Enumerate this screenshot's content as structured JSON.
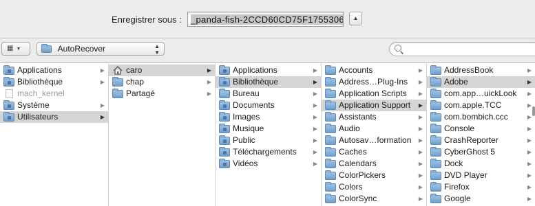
{
  "dialog": {
    "save_as_label": "Enregistrer sous :",
    "filename": "_panda-fish-2CCD60CD75F1755306",
    "expand_symbol": "▲"
  },
  "toolbar": {
    "view_symbol": "▦",
    "location": "AutoRecover",
    "search_placeholder": ""
  },
  "columns": [
    {
      "items": [
        {
          "label": "Applications",
          "icon": "app-folder-icon",
          "selected": false,
          "chevron": true
        },
        {
          "label": "Bibliothèque",
          "icon": "library-folder-icon",
          "selected": false,
          "chevron": true
        },
        {
          "label": "mach_kernel",
          "icon": "file-icon",
          "selected": false,
          "chevron": false,
          "dim": true
        },
        {
          "label": "Système",
          "icon": "system-folder-icon",
          "selected": false,
          "chevron": true
        },
        {
          "label": "Utilisateurs",
          "icon": "users-folder-icon",
          "selected": true,
          "chevron": true
        }
      ]
    },
    {
      "items": [
        {
          "label": "caro",
          "icon": "home-icon",
          "selected": true,
          "chevron": true
        },
        {
          "label": "chap",
          "icon": "folder-icon",
          "selected": false,
          "chevron": true
        },
        {
          "label": "Partagé",
          "icon": "folder-icon",
          "selected": false,
          "chevron": true
        }
      ]
    },
    {
      "items": [
        {
          "label": "Applications",
          "icon": "app-folder-icon",
          "selected": false,
          "chevron": true
        },
        {
          "label": "Bibliothèque",
          "icon": "library-folder-icon",
          "selected": true,
          "chevron": true
        },
        {
          "label": "Bureau",
          "icon": "desktop-folder-icon",
          "selected": false,
          "chevron": true
        },
        {
          "label": "Documents",
          "icon": "documents-folder-icon",
          "selected": false,
          "chevron": true
        },
        {
          "label": "Images",
          "icon": "pictures-folder-icon",
          "selected": false,
          "chevron": true
        },
        {
          "label": "Musique",
          "icon": "music-folder-icon",
          "selected": false,
          "chevron": true
        },
        {
          "label": "Public",
          "icon": "public-folder-icon",
          "selected": false,
          "chevron": true
        },
        {
          "label": "Téléchargements",
          "icon": "downloads-folder-icon",
          "selected": false,
          "chevron": true
        },
        {
          "label": "Vidéos",
          "icon": "movies-folder-icon",
          "selected": false,
          "chevron": true
        }
      ]
    },
    {
      "items": [
        {
          "label": "Accounts",
          "icon": "folder-icon",
          "selected": false,
          "chevron": true
        },
        {
          "label": "Address…Plug-Ins",
          "icon": "folder-icon",
          "selected": false,
          "chevron": true
        },
        {
          "label": "Application Scripts",
          "icon": "folder-icon",
          "selected": false,
          "chevron": true
        },
        {
          "label": "Application Support",
          "icon": "folder-icon",
          "selected": true,
          "chevron": true
        },
        {
          "label": "Assistants",
          "icon": "folder-icon",
          "selected": false,
          "chevron": true
        },
        {
          "label": "Audio",
          "icon": "folder-icon",
          "selected": false,
          "chevron": true
        },
        {
          "label": "Autosav…formation",
          "icon": "folder-icon",
          "selected": false,
          "chevron": true
        },
        {
          "label": "Caches",
          "icon": "folder-icon",
          "selected": false,
          "chevron": true
        },
        {
          "label": "Calendars",
          "icon": "folder-icon",
          "selected": false,
          "chevron": true
        },
        {
          "label": "ColorPickers",
          "icon": "folder-icon",
          "selected": false,
          "chevron": true
        },
        {
          "label": "Colors",
          "icon": "folder-icon",
          "selected": false,
          "chevron": true
        },
        {
          "label": "ColorSync",
          "icon": "folder-icon",
          "selected": false,
          "chevron": true
        }
      ]
    },
    {
      "items": [
        {
          "label": "AddressBook",
          "icon": "folder-icon",
          "selected": false,
          "chevron": true
        },
        {
          "label": "Adobe",
          "icon": "folder-icon",
          "selected": true,
          "chevron": true
        },
        {
          "label": "com.app…uickLook",
          "icon": "folder-icon",
          "selected": false,
          "chevron": true
        },
        {
          "label": "com.apple.TCC",
          "icon": "folder-icon",
          "selected": false,
          "chevron": true
        },
        {
          "label": "com.bombich.ccc",
          "icon": "folder-icon",
          "selected": false,
          "chevron": true
        },
        {
          "label": "Console",
          "icon": "folder-icon",
          "selected": false,
          "chevron": true
        },
        {
          "label": "CrashReporter",
          "icon": "folder-icon",
          "selected": false,
          "chevron": true
        },
        {
          "label": "CyberGhost 5",
          "icon": "folder-icon",
          "selected": false,
          "chevron": true
        },
        {
          "label": "Dock",
          "icon": "folder-icon",
          "selected": false,
          "chevron": true
        },
        {
          "label": "DVD Player",
          "icon": "folder-icon",
          "selected": false,
          "chevron": true
        },
        {
          "label": "Firefox",
          "icon": "folder-icon",
          "selected": false,
          "chevron": true
        },
        {
          "label": "Google",
          "icon": "folder-icon",
          "selected": false,
          "chevron": true
        }
      ]
    }
  ]
}
